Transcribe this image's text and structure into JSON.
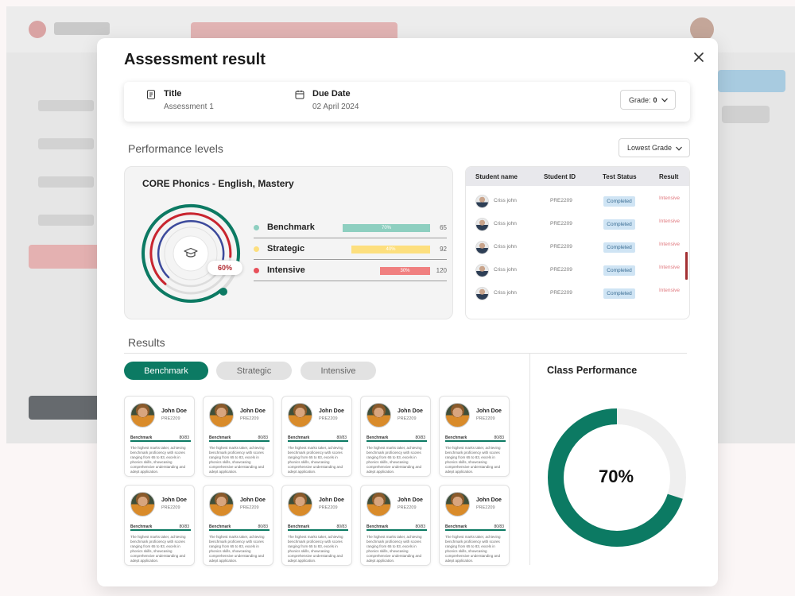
{
  "modal": {
    "title": "Assessment result",
    "info": {
      "title_label": "Title",
      "title_value": "Assessment 1",
      "due_label": "Due Date",
      "due_value": "02 April 2024",
      "grade_label": "Grade:",
      "grade_value": "0"
    },
    "performance": {
      "heading": "Performance levels",
      "sort_select": "Lowest Grade",
      "card_title": "CORE Phonics - English, Mastery",
      "ring_percent": "60%",
      "levels": [
        {
          "label": "Benchmark",
          "percent": "70%",
          "count": "65",
          "color": "#8ecfc0"
        },
        {
          "label": "Strategic",
          "percent": "40%",
          "count": "92",
          "color": "#fddf7e"
        },
        {
          "label": "Intensive",
          "percent": "30%",
          "count": "120",
          "color": "#f08080"
        }
      ]
    },
    "student_table": {
      "headers": [
        "Student name",
        "Student ID",
        "Test Status",
        "Result"
      ],
      "rows": [
        {
          "name": "Criss john",
          "id": "PRE2209",
          "status": "Completed",
          "result": "Intensive"
        },
        {
          "name": "Criss john",
          "id": "PRE2209",
          "status": "Completed",
          "result": "Intensive"
        },
        {
          "name": "Criss john",
          "id": "PRE2209",
          "status": "Completed",
          "result": "Intensive"
        },
        {
          "name": "Criss john",
          "id": "PRE2209",
          "status": "Completed",
          "result": "Intensive"
        },
        {
          "name": "Criss john",
          "id": "PRE2209",
          "status": "Completed",
          "result": "Intensive"
        }
      ]
    },
    "results": {
      "heading": "Results",
      "tabs": [
        "Benchmark",
        "Strategic",
        "Intensive"
      ],
      "cards": [
        {
          "name": "John Doe",
          "id": "PRE2209",
          "tier": "Benchmark",
          "score": "80/83",
          "desc": "The highest marks taker, achieving benchmark proficiency with scores ranging from 65 to 83, excels in phonics skills, showcasing comprehensive understanding and adept application."
        },
        {
          "name": "John Doe",
          "id": "PRE2209",
          "tier": "Benchmark",
          "score": "80/83",
          "desc": "The highest marks taker, achieving benchmark proficiency with scores ranging from 65 to 83, excels in phonics skills, showcasing comprehensive understanding and adept application."
        },
        {
          "name": "John Doe",
          "id": "PRE2209",
          "tier": "Benchmark",
          "score": "80/83",
          "desc": "The highest marks taker, achieving benchmark proficiency with scores ranging from 65 to 83, excels in phonics skills, showcasing comprehensive understanding and adept application."
        },
        {
          "name": "John Doe",
          "id": "PRE2209",
          "tier": "Benchmark",
          "score": "80/83",
          "desc": "The highest marks taker, achieving benchmark proficiency with scores ranging from 65 to 83, excels in phonics skills, showcasing comprehensive understanding and adept application."
        },
        {
          "name": "John Doe",
          "id": "PRE2209",
          "tier": "Benchmark",
          "score": "80/83",
          "desc": "The highest marks taker, achieving benchmark proficiency with scores ranging from 65 to 83, excels in phonics skills, showcasing comprehensive understanding and adept application."
        },
        {
          "name": "John Doe",
          "id": "PRE2209",
          "tier": "Benchmark",
          "score": "80/83",
          "desc": "The highest marks taker, achieving benchmark proficiency with scores ranging from 65 to 83, excels in phonics skills, showcasing comprehensive understanding and adept application."
        },
        {
          "name": "John Doe",
          "id": "PRE2209",
          "tier": "Benchmark",
          "score": "80/83",
          "desc": "The highest marks taker, achieving benchmark proficiency with scores ranging from 65 to 83, excels in phonics skills, showcasing comprehensive understanding and adept application."
        },
        {
          "name": "John Doe",
          "id": "PRE2209",
          "tier": "Benchmark",
          "score": "80/83",
          "desc": "The highest marks taker, achieving benchmark proficiency with scores ranging from 65 to 83, excels in phonics skills, showcasing comprehensive understanding and adept application."
        },
        {
          "name": "John Doe",
          "id": "PRE2209",
          "tier": "Benchmark",
          "score": "80/83",
          "desc": "The highest marks taker, achieving benchmark proficiency with scores ranging from 65 to 83, excels in phonics skills, showcasing comprehensive understanding and adept application."
        },
        {
          "name": "John Doe",
          "id": "PRE2209",
          "tier": "Benchmark",
          "score": "80/83",
          "desc": "The highest marks taker, achieving benchmark proficiency with scores ranging from 65 to 83, excels in phonics skills, showcasing comprehensive understanding and adept application."
        }
      ]
    },
    "class_performance": {
      "title": "Class Performance",
      "percent_label": "70%",
      "value": 0.7
    }
  },
  "colors": {
    "accent": "#0c7a63",
    "danger": "#b0282f"
  },
  "icons": {
    "close": "close-icon",
    "title": "document-icon",
    "due": "calendar-icon",
    "chevron": "chevron-down-icon",
    "ring_center": "graduation-cap-icon"
  }
}
